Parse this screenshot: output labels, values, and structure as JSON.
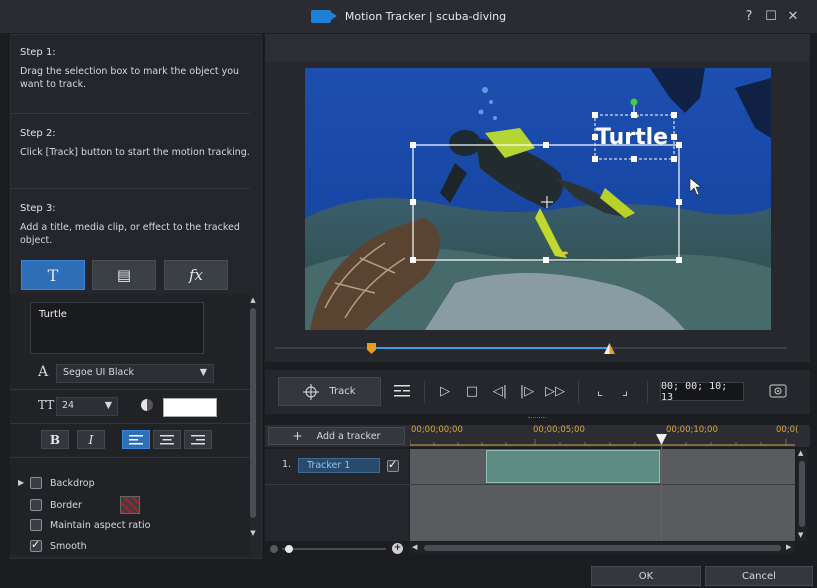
{
  "window": {
    "app_name": "Motion Tracker",
    "separator": "|",
    "project_name": "scuba-diving",
    "help_label": "?",
    "maximize_label": "☐",
    "close_label": "✕"
  },
  "steps": [
    {
      "title": "Step 1:",
      "text": "Drag the selection box to mark the object you want to track."
    },
    {
      "title": "Step 2:",
      "text": "Click [Track] button to start the motion tracking."
    },
    {
      "title": "Step 3:",
      "text": "Add a title, media clip, or effect to the tracked object."
    }
  ],
  "tabs": [
    {
      "icon": "title-text-icon",
      "label": "T"
    },
    {
      "icon": "media-clip-icon",
      "label": "▤"
    },
    {
      "icon": "effect-fx-icon",
      "label": "fx"
    }
  ],
  "text_props": {
    "text_value": "Turtle",
    "font_icon_label": "A",
    "font_name": "Segoe UI Black",
    "size_icon_label": "TT",
    "font_size": "24",
    "bold_label": "B",
    "italic_label": "I",
    "text_color": "#ffffff"
  },
  "options": [
    {
      "label": "Backdrop",
      "checked": false,
      "expandable": true
    },
    {
      "label": "Border",
      "checked": false
    },
    {
      "label": "Maintain aspect ratio",
      "checked": false
    },
    {
      "label": "Smooth",
      "checked": true
    }
  ],
  "preview": {
    "overlay_text": "Turtle"
  },
  "controls": {
    "track_label": "Track",
    "timecode": "00; 00; 10; 13"
  },
  "timeline": {
    "add_tracker_label": "Add a tracker",
    "add_icon": "+",
    "ruler_labels": [
      "00;00;00;00",
      "00;00;05;00",
      "00;00;10;00",
      "00;0("
    ],
    "tracker_index": "1.",
    "tracker_name": "Tracker 1",
    "tracker_enabled": true
  },
  "footer": {
    "ok_label": "OK",
    "cancel_label": "Cancel"
  },
  "colors": {
    "accent": "#2d6fb6",
    "playhead": "#d93030",
    "clip": "#5f8c82",
    "ruler_text": "#d9a640"
  }
}
